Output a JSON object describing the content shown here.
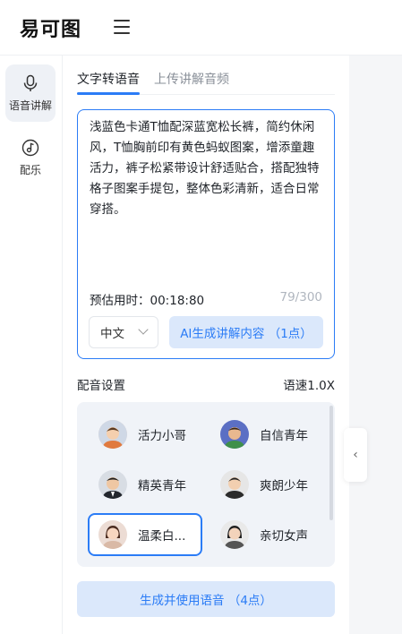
{
  "header": {
    "logo_text": "易可图",
    "menu_icon": "hamburger-icon"
  },
  "sidebar": {
    "items": [
      {
        "label": "语音讲解",
        "icon": "microphone-icon",
        "active": true
      },
      {
        "label": "配乐",
        "icon": "music-note-icon",
        "active": false
      }
    ]
  },
  "tabs": [
    {
      "label": "文字转语音",
      "active": true
    },
    {
      "label": "上传讲解音频",
      "active": false
    }
  ],
  "editor": {
    "text": "浅蓝色卡通T恤配深蓝宽松长裤，简约休闲风，T恤胸前印有黄色蚂蚁图案，增添童趣活力，裤子松紧带设计舒适贴合，搭配独特格子图案手提包，整体色彩清新，适合日常穿搭。",
    "estimate": "预估用时：00:18:80",
    "counter": "79/300",
    "language": "中文",
    "ai_button": "AI生成讲解内容 （1点）"
  },
  "voice_settings": {
    "title": "配音设置",
    "speed": "语速1.0X",
    "voices": [
      {
        "name": "活力小哥",
        "selected": false
      },
      {
        "name": "自信青年",
        "selected": false
      },
      {
        "name": "精英青年",
        "selected": false
      },
      {
        "name": "爽朗少年",
        "selected": false
      },
      {
        "name": "温柔白...",
        "selected": true
      },
      {
        "name": "亲切女声",
        "selected": false
      }
    ]
  },
  "generate_button": "生成并使用语音 （4点）",
  "colors": {
    "accent": "#2b7cf6",
    "accent_light": "#dbe8fb",
    "voice_panel_bg": "#f0f3f8"
  }
}
